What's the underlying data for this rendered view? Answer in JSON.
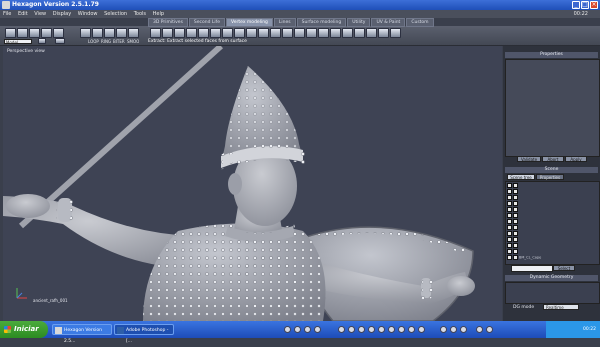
{
  "window": {
    "title": "Hexagon Version 2.5.1.79",
    "clock": "00:22"
  },
  "menu": [
    "File",
    "Edit",
    "View",
    "Display",
    "Window",
    "Selection",
    "Tools",
    "Help"
  ],
  "tabs": [
    {
      "label": "3D Primitives",
      "active": false
    },
    {
      "label": "Second Life",
      "active": false
    },
    {
      "label": "Vertex modeling",
      "active": true
    },
    {
      "label": "Lines",
      "active": false
    },
    {
      "label": "Surface modeling",
      "active": false
    },
    {
      "label": "Utility",
      "active": false
    },
    {
      "label": "UV & Paint",
      "active": false
    },
    {
      "label": "Custom",
      "active": false
    }
  ],
  "toolbar": {
    "combo_value": "Model",
    "status_message": "Extract: Extract selected faces from surface",
    "loop_label": "LOOP",
    "ring_label": "RING",
    "biter_label": "BITER",
    "smooth_label": "SMOO"
  },
  "viewport": {
    "label": "Perspective view",
    "object_label": "ancient_rafh_001"
  },
  "panels": {
    "properties": {
      "title": "Properties",
      "validate": "Validate",
      "abort": "Abort",
      "apply": "Apply"
    },
    "scene": {
      "title": "Scene",
      "tabs": [
        "Scene tree",
        "Properties"
      ],
      "items": [
        "",
        "",
        "",
        "",
        "",
        "",
        "",
        "",
        "",
        "",
        "",
        "",
        "BM_CL_Cape"
      ],
      "select_button": "Select"
    },
    "dynamic_geometry": {
      "title": "Dynamic Geometry",
      "mode_label": "DG mode",
      "mode_value": "Realtime"
    }
  },
  "taskbar": {
    "start": "Iniciar",
    "tasks": [
      "Hexagon Version 2.5...",
      "Adobe Photoshop - [..."
    ],
    "time": "00:22"
  },
  "colors": {
    "titlebar": "#245edb",
    "viewport_bg": "#3e4354",
    "taskbar": "#2457d0"
  }
}
